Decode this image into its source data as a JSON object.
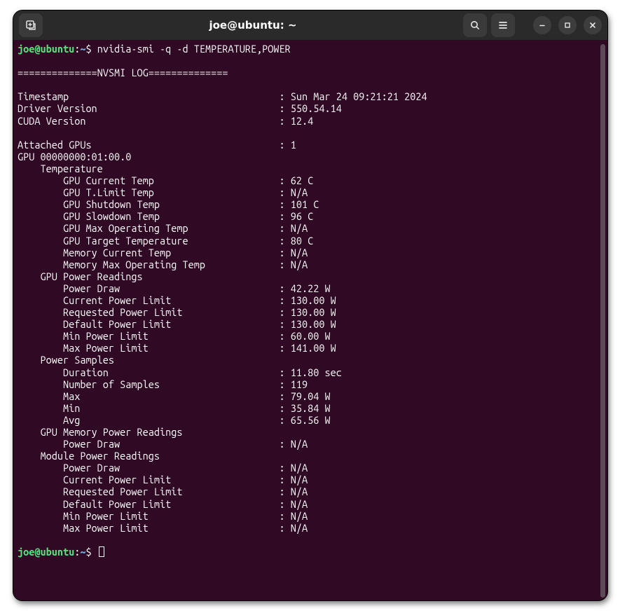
{
  "title": "joe@ubuntu: ~",
  "prompt": {
    "user": "joe",
    "at": "@",
    "host": "ubuntu",
    "colon": ":",
    "path": "~",
    "dollar": "$"
  },
  "command": "nvidia-smi -q -d TEMPERATURE,POWER",
  "banner": "==============NVSMI LOG==============",
  "header": [
    {
      "label": "Timestamp",
      "value": "Sun Mar 24 09:21:21 2024"
    },
    {
      "label": "Driver Version",
      "value": "550.54.14"
    },
    {
      "label": "CUDA Version",
      "value": "12.4"
    }
  ],
  "attached_label": "Attached GPUs",
  "attached_value": "1",
  "gpu_label": "GPU 00000000:01:00.0",
  "groups": [
    {
      "name": "Temperature",
      "rows": [
        {
          "label": "GPU Current Temp",
          "value": "62 C"
        },
        {
          "label": "GPU T.Limit Temp",
          "value": "N/A"
        },
        {
          "label": "GPU Shutdown Temp",
          "value": "101 C"
        },
        {
          "label": "GPU Slowdown Temp",
          "value": "96 C"
        },
        {
          "label": "GPU Max Operating Temp",
          "value": "N/A"
        },
        {
          "label": "GPU Target Temperature",
          "value": "80 C"
        },
        {
          "label": "Memory Current Temp",
          "value": "N/A"
        },
        {
          "label": "Memory Max Operating Temp",
          "value": "N/A"
        }
      ]
    },
    {
      "name": "GPU Power Readings",
      "rows": [
        {
          "label": "Power Draw",
          "value": "42.22 W"
        },
        {
          "label": "Current Power Limit",
          "value": "130.00 W"
        },
        {
          "label": "Requested Power Limit",
          "value": "130.00 W"
        },
        {
          "label": "Default Power Limit",
          "value": "130.00 W"
        },
        {
          "label": "Min Power Limit",
          "value": "60.00 W"
        },
        {
          "label": "Max Power Limit",
          "value": "141.00 W"
        }
      ]
    },
    {
      "name": "Power Samples",
      "rows": [
        {
          "label": "Duration",
          "value": "11.80 sec"
        },
        {
          "label": "Number of Samples",
          "value": "119"
        },
        {
          "label": "Max",
          "value": "79.04 W"
        },
        {
          "label": "Min",
          "value": "35.84 W"
        },
        {
          "label": "Avg",
          "value": "65.56 W"
        }
      ]
    },
    {
      "name": "GPU Memory Power Readings",
      "rows": [
        {
          "label": "Power Draw",
          "value": "N/A"
        }
      ]
    },
    {
      "name": "Module Power Readings",
      "rows": [
        {
          "label": "Power Draw",
          "value": "N/A"
        },
        {
          "label": "Current Power Limit",
          "value": "N/A"
        },
        {
          "label": "Requested Power Limit",
          "value": "N/A"
        },
        {
          "label": "Default Power Limit",
          "value": "N/A"
        },
        {
          "label": "Min Power Limit",
          "value": "N/A"
        },
        {
          "label": "Max Power Limit",
          "value": "N/A"
        }
      ]
    }
  ]
}
